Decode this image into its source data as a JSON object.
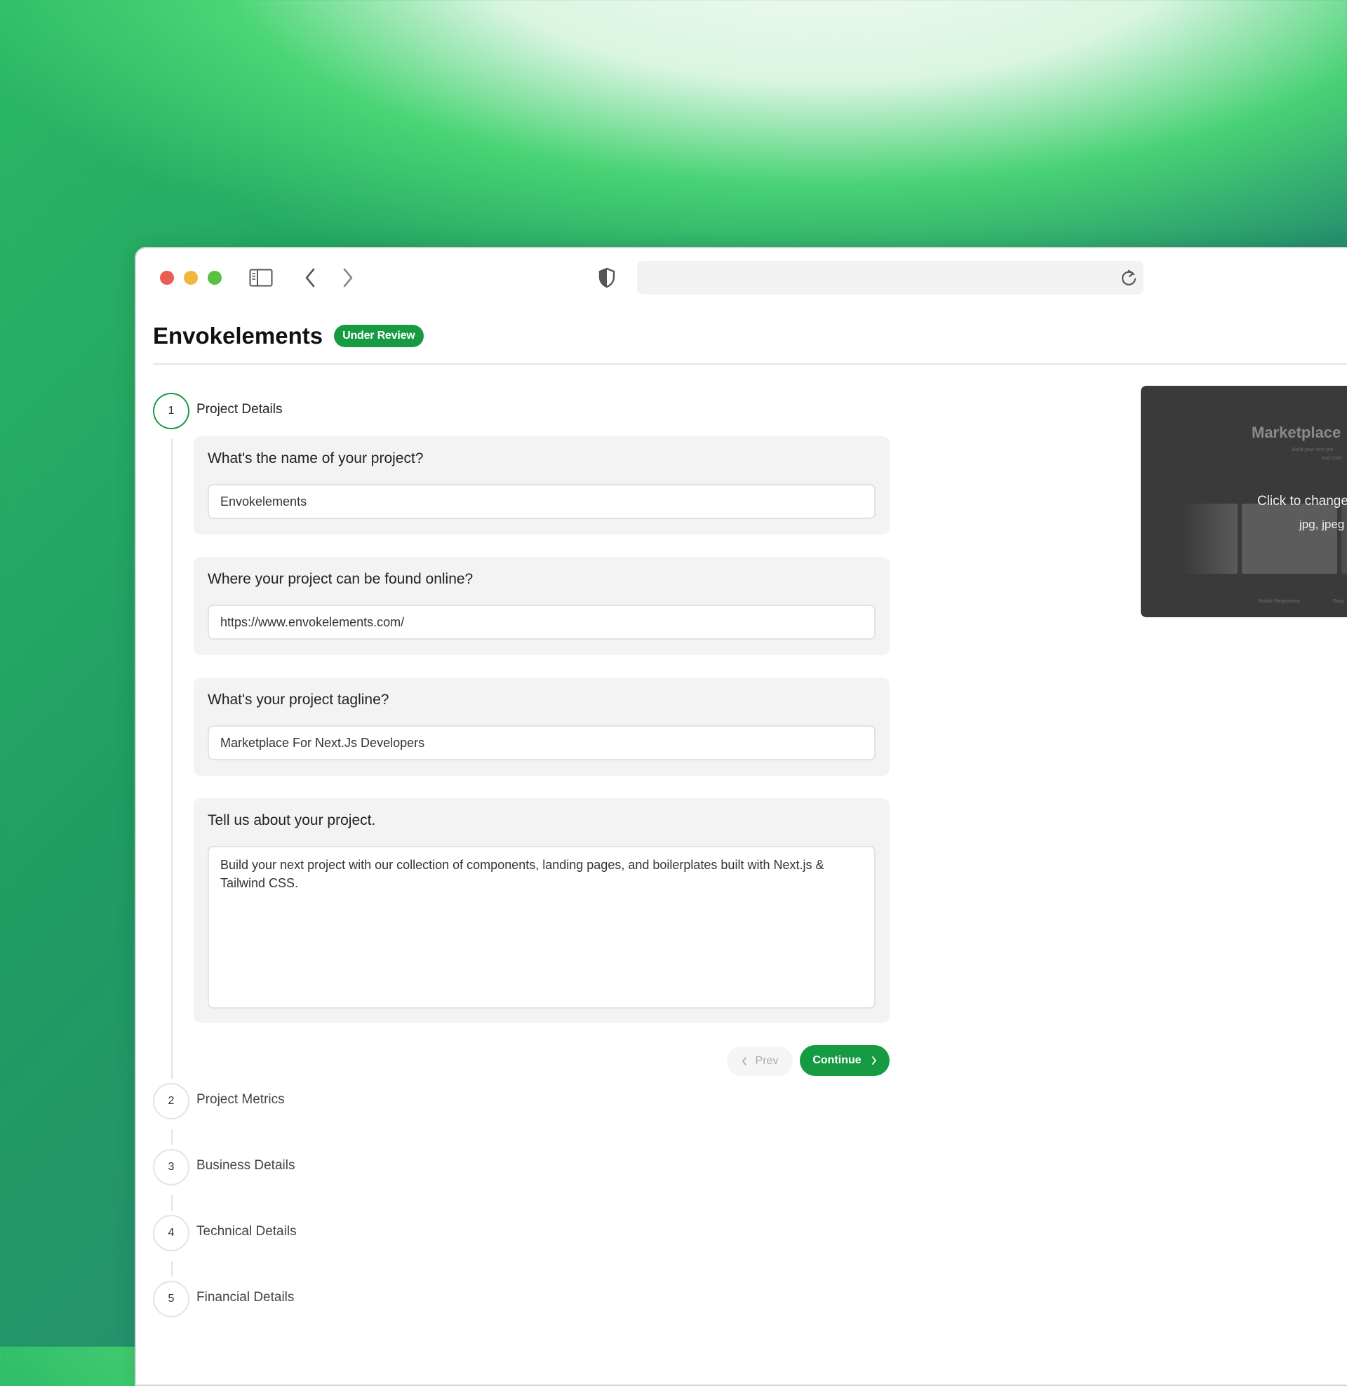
{
  "colors": {
    "accent": "#169b43",
    "traffic_red": "#ec5c51",
    "traffic_yellow": "#f0b73a",
    "traffic_green": "#58c043"
  },
  "toolbar": {
    "icons": [
      "sidebar-toggle-icon",
      "back-chevron-icon",
      "forward-chevron-icon",
      "shield-icon",
      "reload-icon"
    ],
    "url_value": ""
  },
  "header": {
    "title": "Envokelements",
    "badge": "Under Review"
  },
  "steps": [
    {
      "number": "1",
      "label": "Project Details",
      "active": true
    },
    {
      "number": "2",
      "label": "Project Metrics",
      "active": false
    },
    {
      "number": "3",
      "label": "Business Details",
      "active": false
    },
    {
      "number": "4",
      "label": "Technical Details",
      "active": false
    },
    {
      "number": "5",
      "label": "Financial Details",
      "active": false
    }
  ],
  "form": {
    "name": {
      "question": "What's the name of your project?",
      "value": "Envokelements"
    },
    "url": {
      "question": "Where your project can be found online?",
      "value": "https://www.envokelements.com/"
    },
    "tagline": {
      "question": "What's your project tagline?",
      "value": "Marketplace For Next.Js Developers"
    },
    "about": {
      "question": "Tell us about your project.",
      "value": "Build your next project with our collection of components, landing pages, and boilerplates built with Next.js & Tailwind CSS."
    }
  },
  "nav": {
    "prev": "Prev",
    "continue": "Continue"
  },
  "preview": {
    "title": "Marketplace",
    "sub_line1": "Build your next pro",
    "sub_line2": "and color",
    "click_text": "Click to change",
    "formats": "jpg, jpeg",
    "foot1": "Mobile Responsive",
    "foot2": "Easy"
  }
}
